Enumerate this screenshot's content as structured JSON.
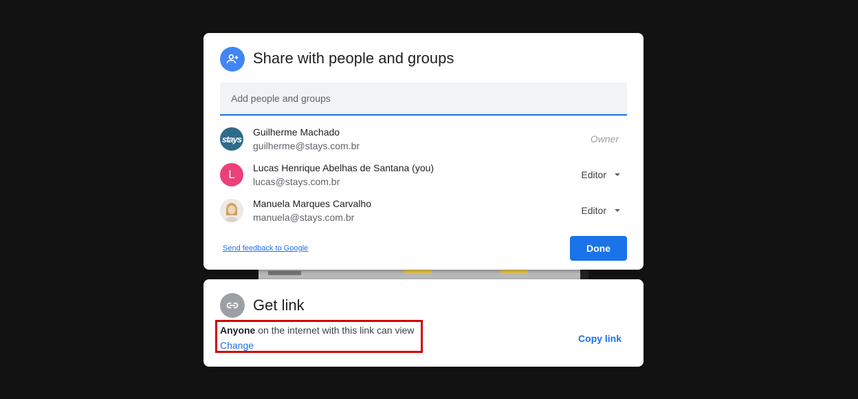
{
  "share_dialog": {
    "title": "Share with people and groups",
    "add_placeholder": "Add people and groups",
    "people": [
      {
        "name": "Guilherme Machado",
        "email": "guilherme@stays.com.br",
        "avatar_text": "stays",
        "role": "Owner"
      },
      {
        "name": "Lucas Henrique Abelhas de Santana (you)",
        "email": "lucas@stays.com.br",
        "avatar_text": "L",
        "role": "Editor"
      },
      {
        "name": "Manuela Marques Carvalho",
        "email": "manuela@stays.com.br",
        "role": "Editor"
      }
    ],
    "feedback_link": "Send feedback to Google",
    "done_label": "Done"
  },
  "get_link": {
    "title": "Get link",
    "access_bold": "Anyone",
    "access_rest": " on the internet with this link can view",
    "change_label": "Change",
    "copy_label": "Copy link"
  },
  "icons": {
    "share_header": "person-add-icon",
    "link_header": "link-icon",
    "dropdown": "caret-down-icon"
  },
  "colors": {
    "primary": "#1a73e8",
    "share_icon_bg": "#4285f4",
    "link_icon_bg": "#9aa0a6",
    "highlight_border": "#d50000",
    "backdrop": "#121212"
  }
}
